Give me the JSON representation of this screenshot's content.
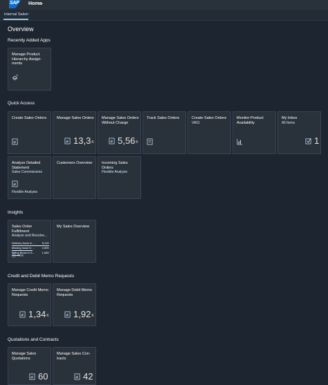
{
  "shell": {
    "logo_text": "SAP",
    "home_label": "Home",
    "home_caret": "▾"
  },
  "tabs": {
    "active_label": "Internal Sales",
    "caret": "⌵"
  },
  "page": {
    "title": "Overview"
  },
  "sections": {
    "recent": "Recently Added Apps",
    "quick": "Quick Access",
    "insights": "Insights",
    "credit": "Credit and Debit Memo Requests",
    "quotations": "Quotations and Contracts"
  },
  "recent_tiles": [
    {
      "title": "Manage Product Hierarchy Assign-ments",
      "icon": "hierarchy-icon"
    }
  ],
  "quick_tiles": [
    {
      "title": "Create Sales Orders",
      "subtitle": "",
      "icon": "document-icon"
    },
    {
      "title": "Manage Sales Orders",
      "subtitle": "",
      "icon": "document-icon",
      "kpi": "13,3",
      "unit": "K"
    },
    {
      "title": "Manage Sales Orders Without Charge",
      "subtitle": "",
      "icon": "document-icon",
      "kpi": "5,56",
      "unit": "K"
    },
    {
      "title": "Track Sales Orders",
      "subtitle": "",
      "icon": "document-icon"
    },
    {
      "title": "Create Sales Orders",
      "subtitle": "VA01",
      "icon": "document-icon"
    },
    {
      "title": "Monitor Product Availability",
      "subtitle": "",
      "icon": "chart-icon"
    },
    {
      "title": "My Inbox",
      "subtitle": "All Items",
      "icon": "checkbox-icon",
      "kpi": "1",
      "unit": ""
    },
    {
      "title": "Analyze Detailed Statement",
      "subtitle": "Sales Commissions",
      "icon": "document-icon",
      "footer": "Flexible Analysis"
    },
    {
      "title": "Customers Overview",
      "subtitle": "",
      "icon": ""
    },
    {
      "title": "Incoming Sales Orders",
      "subtitle": "Flexible Analysis",
      "icon": ""
    }
  ],
  "insight_tiles": [
    {
      "title": "Sales Order Fulfillment",
      "subtitle": "Analyze and Resolve...",
      "rows": [
        {
          "label": "Delivery Issue in ...",
          "value": "8,11K",
          "fill": 1.0
        },
        {
          "label": "Missing Issue in ...",
          "value": "4,52K",
          "fill": 0.56
        },
        {
          "label": "Billing Block in S...",
          "value": "1,84K",
          "fill": 0.23
        }
      ],
      "footer": "now"
    },
    {
      "title": "My Sales Overview",
      "subtitle": ""
    }
  ],
  "credit_tiles": [
    {
      "title": "Manage Credit Memo Requests",
      "kpi": "1,34",
      "unit": "K"
    },
    {
      "title": "Manage Debit Memo Requests",
      "kpi": "1,92",
      "unit": "K"
    }
  ],
  "quotation_tiles": [
    {
      "title": "Manage Sales Quotations",
      "kpi": "60",
      "unit": ""
    },
    {
      "title": "Manage Sales Con-tracts",
      "kpi": "42",
      "unit": ""
    }
  ],
  "colors": {
    "shell": "#29313a",
    "background": "#1d2530",
    "tile": "#29313a",
    "accent": "#91c8f6"
  }
}
